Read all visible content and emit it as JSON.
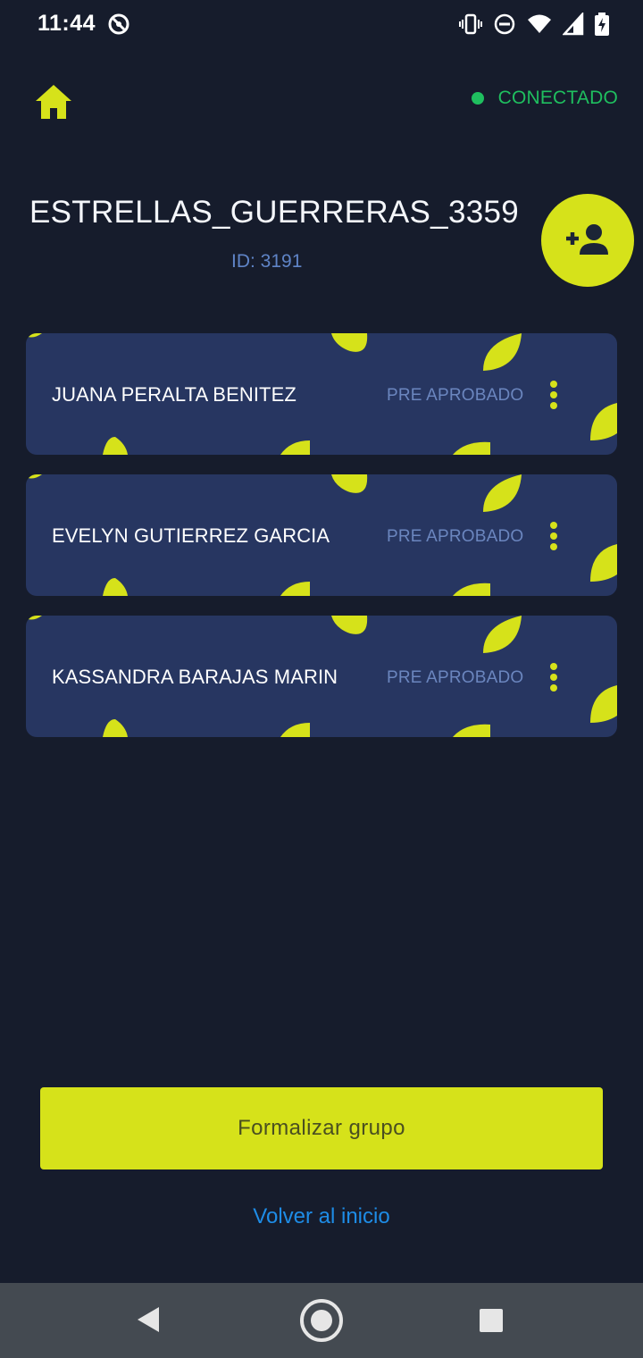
{
  "status_bar": {
    "time": "11:44",
    "icons": [
      "app-notification-icon",
      "vibrate-icon",
      "do-not-disturb-icon",
      "wifi-icon",
      "signal-icon",
      "battery-charging-icon"
    ]
  },
  "header": {
    "home_icon": "home-icon",
    "connection_status": "CONECTADO",
    "connection_color": "#1fbf5f"
  },
  "group": {
    "name": "ESTRELLAS_GUERRERAS_3359",
    "id_label": "ID: 3191",
    "add_member_icon": "person-add-icon"
  },
  "members": [
    {
      "name": "JUANA PERALTA BENITEZ",
      "status": "PRE APROBADO"
    },
    {
      "name": "EVELYN GUTIERREZ GARCIA",
      "status": "PRE APROBADO"
    },
    {
      "name": "KASSANDRA BARAJAS MARIN",
      "status": "PRE APROBADO"
    }
  ],
  "actions": {
    "formalize_label": "Formalizar grupo",
    "back_home_label": "Volver al inicio"
  },
  "colors": {
    "background": "#161c2c",
    "card": "#273661",
    "accent": "#d6e21a",
    "link": "#1e8ce6"
  },
  "nav_bar": {
    "icons": [
      "back-icon",
      "home-circle-icon",
      "recents-icon"
    ]
  }
}
